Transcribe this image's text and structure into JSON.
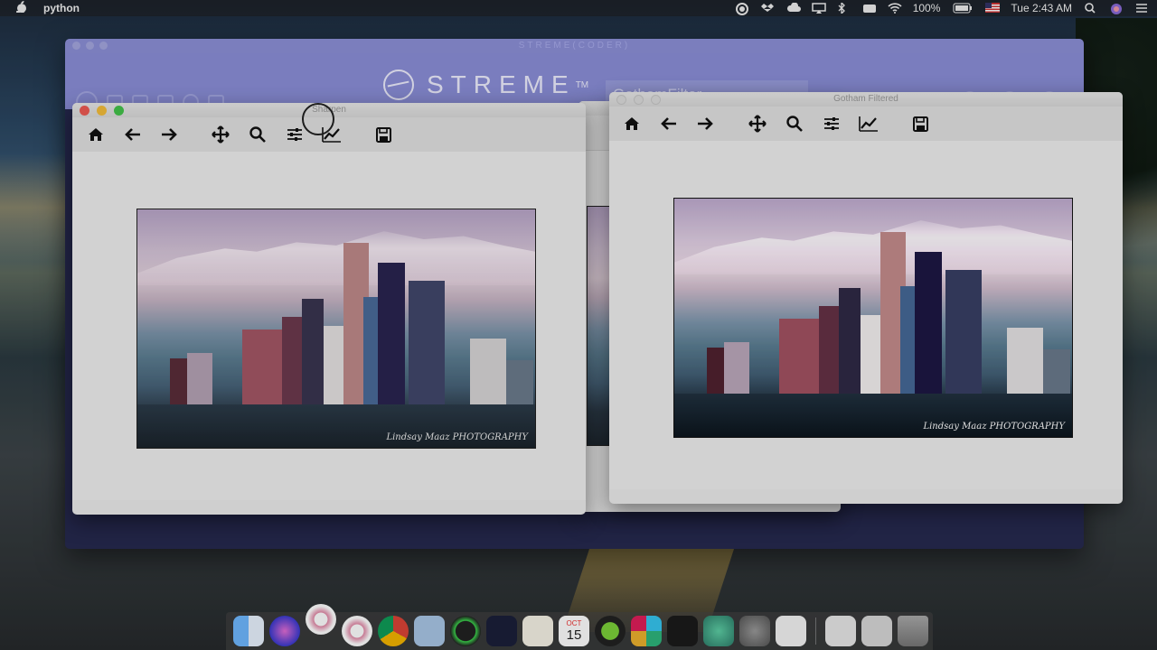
{
  "menubar": {
    "apple": "",
    "app_name": "python",
    "battery": "100%",
    "clock": "Tue 2:43 AM"
  },
  "streme": {
    "window_title": "STREME(CODER)",
    "logo_text": "STREME",
    "logo_tm": "TM",
    "filter_field": "GothamFilter"
  },
  "sharpen_window": {
    "title": "Sharpen",
    "watermark": "Lindsay Maaz PHOTOGRAPHY"
  },
  "gotham_window": {
    "title": "Gotham Filtered",
    "watermark": "Lindsay Maaz PHOTOGRAPHY"
  },
  "toolbar": {
    "home": "⌂",
    "back": "←",
    "forward": "→",
    "pan": "✥",
    "zoom": "⚲",
    "configure": "☰",
    "axes": "〽",
    "save": "🖫"
  },
  "dock": {
    "calendar_month": "OCT",
    "calendar_day": "15"
  },
  "colors": {
    "streme_header": "#8b8fd9",
    "streme_body": "#26294f",
    "close": "#ee5b52",
    "minimize": "#f4bd3b",
    "maximize": "#44c34b"
  }
}
